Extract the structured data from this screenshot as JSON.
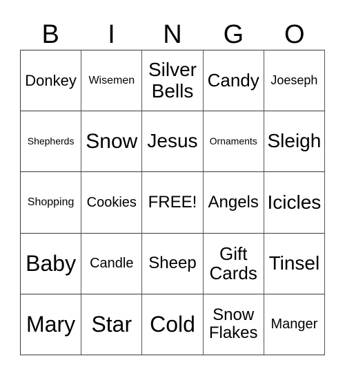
{
  "header": {
    "letters": [
      "B",
      "I",
      "N",
      "G",
      "O"
    ]
  },
  "grid": {
    "rows": [
      [
        "Donkey",
        "Wisemen",
        "Silver Bells",
        "Candy",
        "Joeseph"
      ],
      [
        "Shepherds",
        "Snow",
        "Jesus",
        "Ornaments",
        "Sleigh"
      ],
      [
        "Shopping",
        "Cookies",
        "FREE!",
        "Angels",
        "Icicles"
      ],
      [
        "Baby",
        "Candle",
        "Sheep",
        "Gift Cards",
        "Tinsel"
      ],
      [
        "Mary",
        "Star",
        "Cold",
        "Snow Flakes",
        "Manger"
      ]
    ]
  }
}
